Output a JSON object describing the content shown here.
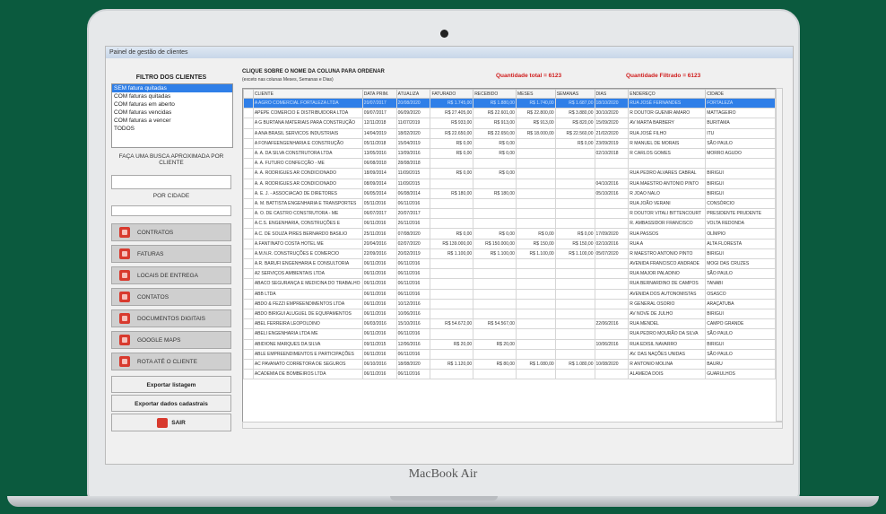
{
  "device": {
    "brand": "MacBook Air"
  },
  "window": {
    "title": "Painel de gestão de clientes"
  },
  "sidebar": {
    "filter_title": "FILTRO DOS CLIENTES",
    "filter_options": [
      "SEM fatura quitadas",
      "COM faturas quitadas",
      "COM faturas em aberto",
      "COM faturas vencidas",
      "COM faturas a vencer",
      "TODOS"
    ],
    "selected_index": 0,
    "search_client_label": "FAÇA UMA BUSCA APROXIMADA POR CLIENTE",
    "search_city_label": "POR CIDADE",
    "menu": [
      {
        "label": "CONTRATOS",
        "icon": "contract-icon"
      },
      {
        "label": "FATURAS",
        "icon": "invoice-icon"
      },
      {
        "label": "LOCAIS DE ENTREGA",
        "icon": "delivery-icon"
      },
      {
        "label": "CONTATOS",
        "icon": "contacts-icon"
      },
      {
        "label": "DOCUMENTOS DIGITAIS",
        "icon": "documents-icon"
      },
      {
        "label": "GOOGLE MAPS",
        "icon": "map-pin-icon"
      },
      {
        "label": "ROTA ATÉ O CLIENTE",
        "icon": "route-icon"
      }
    ],
    "export_list": "Exportar listagem",
    "export_data": "Exportar dados cadastrais",
    "exit": "SAIR"
  },
  "main": {
    "hint_title": "CLIQUE SOBRE O NOME DA COLUNA PARA ORDENAR",
    "hint_sub": "(exceto nas colunas Meses, Semanas e Dias)",
    "total_qty": "Quantidade total = 6123",
    "filtered_qty": "Quantidade Filtrado = 6123",
    "accent_red": "#d01d1d",
    "selection_blue": "#2f7fe8"
  },
  "grid": {
    "columns": [
      "CLIENTE",
      "DATA PRIM.",
      "ATUALIZA",
      "FATURADO",
      "RECEBIDO",
      "MESES",
      "SEMANAS",
      "DIAS",
      "ENDEREÇO",
      "CIDADE"
    ],
    "rows": [
      [
        "A AGRO COMERCIAL FORTALEZA LTDA",
        "20/07/2017",
        "20/08/2020",
        "R$ 1.745,00",
        "R$ 1.880,00",
        "R$ 1.740,00",
        "R$ 1.687,00",
        "18/10/2020",
        "RUA JOSÉ FERNANDES",
        "FORTALEZA"
      ],
      [
        "APEPE COMERCIO E DISTRIBUIDORA LTDA",
        "09/07/2017",
        "06/09/2020",
        "R$ 27.405,00",
        "R$ 22.601,00",
        "R$ 22.800,00",
        "R$ 3.880,00",
        "30/10/2020",
        "R DOUTOR GUENIR AMARO",
        "MATTAGEIRO"
      ],
      [
        "A G BURTANA MATERIAIS PARA CONSTRUÇÃO",
        "12/11/2018",
        "11/07/2019",
        "R$ 933,00",
        "R$ 913,00",
        "R$ 913,00",
        "R$ 820,00",
        "15/09/2020",
        "AV MARTA BARBERY",
        "BURITAMA"
      ],
      [
        "A ANA BRASIL SERVICOS INDUSTRIAIS",
        "14/04/2019",
        "18/02/2020",
        "R$ 22.650,00",
        "R$ 22.650,00",
        "R$ 18.000,00",
        "R$ 22.560,00",
        "21/02/2020",
        "RUA JOSÉ FILHO",
        "ITU"
      ],
      [
        "A FONAFEENGENHARIA E CONSTRUÇÃO",
        "05/11/2018",
        "15/04/2019",
        "R$ 0,00",
        "R$ 0,00",
        "",
        "R$ 0,00",
        "23/09/2019",
        "R MANUEL DE MORAIS",
        "SÃO PAULO"
      ],
      [
        "A. A. DA SILVA CONSTRUTORA LTDA",
        "13/05/2016",
        "13/09/2016",
        "R$ 0,00",
        "R$ 0,00",
        "",
        "",
        "02/10/2018",
        "R CARLOS GOMES",
        "MORRO AGUDO"
      ],
      [
        "A. A. FUTURO CONFECÇÃO - ME",
        "06/08/2018",
        "28/08/2018",
        "",
        "",
        "",
        "",
        "",
        "",
        ""
      ],
      [
        "A. A. RODRIGUES AR CONDICIONADO",
        "18/09/2014",
        "11/09/2015",
        "R$ 0,00",
        "R$ 0,00",
        "",
        "",
        "",
        "RUA PEDRO ALVARES CABRAL",
        "BIRIGUI"
      ],
      [
        "A. A. RODRIGUES AR CONDICIONADO",
        "08/09/2014",
        "11/09/2015",
        "",
        "",
        "",
        "",
        "04/10/2016",
        "RUA MAESTRO ANTONIO PINTO",
        "BIRIGUI"
      ],
      [
        "A. E. J. - ASSOCIACAO DE DIRETORES",
        "06/05/2014",
        "06/08/2014",
        "R$ 180,00",
        "R$ 180,00",
        "",
        "",
        "05/10/2016",
        "R JOAO NALO",
        "BIRIGUI"
      ],
      [
        "A. M. BATTISTA ENGENHARIA E TRANSPORTES",
        "05/11/2016",
        "06/11/2016",
        "",
        "",
        "",
        "",
        "",
        "RUA JOÃO VERANI",
        "CONSÓRCIO"
      ],
      [
        "A. O. DE CASTRO CONSTRUTORA - ME",
        "06/07/2017",
        "20/07/2017",
        "",
        "",
        "",
        "",
        "",
        "R DOUTOR VITALI BITTENCOURT",
        "PRESIDENTE PRUDENTE"
      ],
      [
        "A.C.S. ENGENHARIA, CONSTRUÇÕES E",
        "06/11/2016",
        "26/11/2016",
        "",
        "",
        "",
        "",
        "",
        "R. AMBASSIDOR FRANCISCO",
        "VOLTA REDONDA"
      ],
      [
        "A.C. DE SOUZA PIRES BERNARDO BASILIO",
        "25/11/2016",
        "07/08/2020",
        "R$ 0,00",
        "R$ 0,00",
        "R$ 0,00",
        "R$ 0,00",
        "17/09/2020",
        "RUA PASSOS",
        "OLÍMPIO"
      ],
      [
        "A.FANTINATO COSTA HOTEL ME",
        "20/04/2016",
        "02/07/2020",
        "R$ 139.000,00",
        "R$ 150.000,00",
        "R$ 150,00",
        "R$ 150,00",
        "02/10/2016",
        "RUA A",
        "ALTA FLORESTA"
      ],
      [
        "A.M.N.R. CONSTRUÇÕES E COMERCIO",
        "22/09/2016",
        "20/02/2019",
        "R$ 1.100,00",
        "R$ 1.100,00",
        "R$ 1.100,00",
        "R$ 1.100,00",
        "05/07/2020",
        "R MAESTRO ANTONIO PINTO",
        "BIRIGUI"
      ],
      [
        "A.R. BARUFI ENGENHARIA E CONSULTORIA",
        "06/11/2016",
        "06/11/2016",
        "",
        "",
        "",
        "",
        "",
        "AVENIDA FRANCISCO ANDRADE",
        "MOGI DAS CRUZES"
      ],
      [
        "A2 SERVIÇOS AMBIENTAIS LTDA",
        "06/11/2016",
        "06/11/2016",
        "",
        "",
        "",
        "",
        "",
        "RUA MAJOR PALADINO",
        "SÃO PAULO"
      ],
      [
        "ABACO SEGURANÇA E MEDICINA DO TRABALHO",
        "06/11/2016",
        "06/11/2016",
        "",
        "",
        "",
        "",
        "",
        "RUA BERNARDINO DE CAMPOS",
        "TANABI"
      ],
      [
        "ABB LTDA",
        "06/11/2016",
        "06/11/2016",
        "",
        "",
        "",
        "",
        "",
        "AVENIDA DOS AUTONOMISTAS",
        "OSASCO"
      ],
      [
        "ABDO & FEZZI EMPREENDIMENTOS LTDA",
        "06/11/2016",
        "10/12/2016",
        "",
        "",
        "",
        "",
        "",
        "R GENERAL OSORIO",
        "ARAÇATUBA"
      ],
      [
        "ABDO BIRIGUI ALUGUEL DE EQUIPAMENTOS",
        "06/11/2016",
        "10/06/2016",
        "",
        "",
        "",
        "",
        "",
        "AV NOVE DE JULHO",
        "BIRIGUI"
      ],
      [
        "ABEL FERREIRA LEOPOLDINO",
        "06/03/2016",
        "15/10/2016",
        "R$ 54.672,00",
        "R$ 54.567,00",
        "",
        "",
        "22/06/2016",
        "RUA MENDEL",
        "CAMPO GRANDE"
      ],
      [
        "ABELI ENGENHARIA LTDA ME",
        "06/11/2016",
        "06/11/2016",
        "",
        "",
        "",
        "",
        "",
        "RUA PEDRO MOURÃO DA SILVA",
        "SÃO PAULO"
      ],
      [
        "ABIDIONE MARQUES DA SILVA",
        "09/11/2015",
        "12/06/2016",
        "R$ 20,00",
        "R$ 20,00",
        "",
        "",
        "10/06/2016",
        "RUA EDISIL NAVARRO",
        "BIRIGUI"
      ],
      [
        "ABLE EMPREENDIMENTOS E PARTICIPAÇÕES",
        "06/11/2016",
        "06/11/2016",
        "",
        "",
        "",
        "",
        "",
        "AV. DAS NAÇÕES UNIDAS",
        "SÃO PAULO"
      ],
      [
        "AC PAVANATO CORRETORA DE SEGUROS",
        "06/10/2016",
        "18/08/2020",
        "R$ 1.120,00",
        "R$ 80,00",
        "R$ 1.080,00",
        "R$ 1.080,00",
        "10/08/2020",
        "R ANTONIO MOLINA",
        "BAURU"
      ],
      [
        "ACADEMIA DE BOMBEIROS LTDA",
        "06/11/2016",
        "06/11/2016",
        "",
        "",
        "",
        "",
        "",
        "ALAMEDA DOIS",
        "GUARULHOS"
      ]
    ]
  }
}
